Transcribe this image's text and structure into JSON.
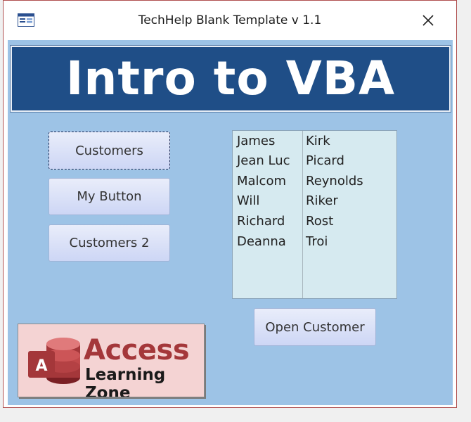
{
  "window": {
    "title": "TechHelp Blank Template v 1.1",
    "close_symbol": "✕"
  },
  "icons": {
    "app": "form-icon",
    "close": "close-icon"
  },
  "banner": {
    "title": "Intro to VBA"
  },
  "buttons": {
    "customers": "Customers",
    "my_button": "My Button",
    "customers_2": "Customers 2",
    "open_customer": "Open Customer"
  },
  "listbox": {
    "rows": [
      {
        "first": "James",
        "last": "Kirk"
      },
      {
        "first": "Jean Luc",
        "last": "Picard"
      },
      {
        "first": "Malcom",
        "last": "Reynolds"
      },
      {
        "first": "Will",
        "last": "Riker"
      },
      {
        "first": "Richard",
        "last": "Rost"
      },
      {
        "first": "Deanna",
        "last": "Troi"
      }
    ]
  },
  "logo": {
    "word1": "Access",
    "word2": "Learning Zone",
    "mark_letter": "A"
  },
  "colors": {
    "form_background": "#9dc3e6",
    "banner_background": "#1f4e87",
    "listbox_background": "#d6eaf0",
    "logo_background": "#f4d3d3",
    "access_red": "#a4373a"
  }
}
